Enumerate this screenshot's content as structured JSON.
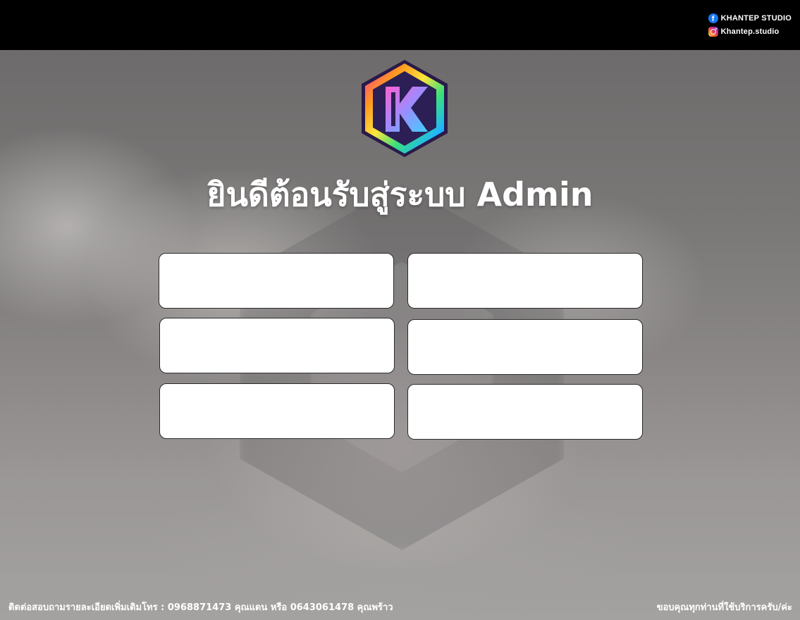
{
  "header": {
    "facebook": {
      "icon": "facebook-icon",
      "label": "KHANTEP STUDIO"
    },
    "instagram": {
      "icon": "instagram-icon",
      "label": "Khantep.studio"
    }
  },
  "logo": {
    "icon": "k-hexagon-logo",
    "letter": "K"
  },
  "title": "ยินดีต้อนรับสู่ระบบ Admin",
  "menu_boxes": [
    {
      "label": ""
    },
    {
      "label": ""
    },
    {
      "label": ""
    },
    {
      "label": ""
    },
    {
      "label": ""
    },
    {
      "label": ""
    }
  ],
  "footer": {
    "contact": "ติดต่อสอบถามรายละเอียดเพิ่มเติมโทร : 0968871473 คุณแดน หรือ 0643061478 คุณพร้าว",
    "thanks": "ขอบคุณทุกท่านที่ใช้บริการครับ/ค่ะ"
  },
  "colors": {
    "topbar": "#000000",
    "facebook": "#1877f2",
    "box_background": "#ffffff",
    "text": "#ffffff"
  }
}
